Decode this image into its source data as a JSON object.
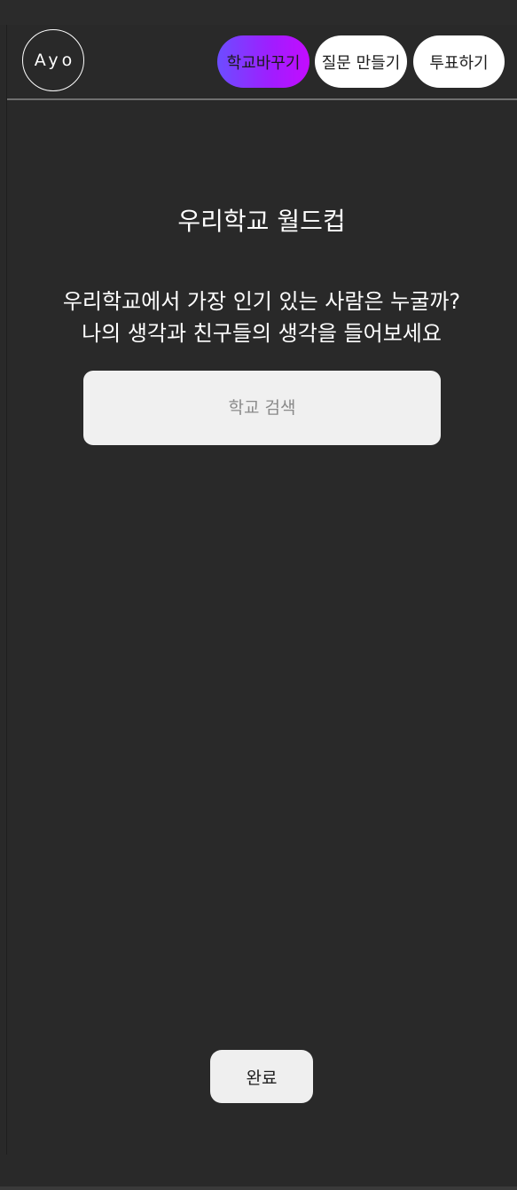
{
  "header": {
    "logo_text": "Ayo",
    "nav": {
      "change_school": "학교바꾸기",
      "make_question": "질문 만들기",
      "vote": "투표하기"
    }
  },
  "main": {
    "title": "우리학교 월드컵",
    "subtitle_line1": "우리학교에서 가장 인기 있는 사람은 누굴까?",
    "subtitle_line2": "나의 생각과 친구들의 생각을 들어보세요",
    "search": {
      "placeholder": "학교 검색",
      "value": ""
    },
    "done_label": "완료"
  },
  "colors": {
    "background": "#292929",
    "active_gradient_start": "#6c4dff",
    "active_gradient_end": "#c40cff",
    "button_bg": "#ffffff",
    "input_bg": "#f0f0f0"
  }
}
